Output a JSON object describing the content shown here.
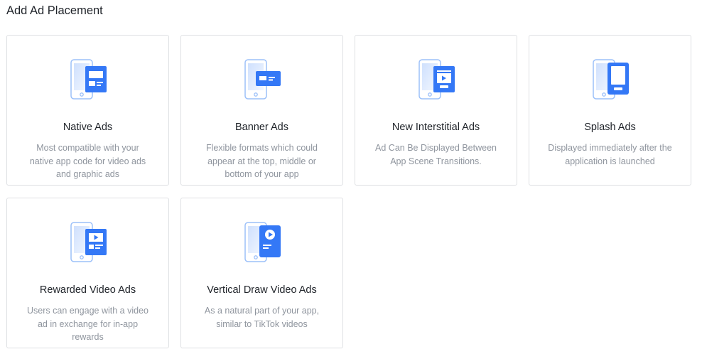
{
  "page": {
    "title": "Add Ad Placement"
  },
  "colors": {
    "accent": "#3478f6",
    "phone_outline": "#9cc0f9",
    "phone_fill": "#e6effe",
    "card_border": "#dee0e3",
    "title_text": "#1f2329",
    "desc_text": "#8f959e"
  },
  "placements": [
    {
      "icon": "native-ads-icon",
      "title": "Native Ads",
      "description": "Most compatible with your native app code for video ads and graphic ads"
    },
    {
      "icon": "banner-ads-icon",
      "title": "Banner Ads",
      "description": "Flexible formats which could appear at the top, middle or bottom of your app"
    },
    {
      "icon": "interstitial-ads-icon",
      "title": "New Interstitial Ads",
      "description": "Ad Can Be Displayed Between App Scene Transitions."
    },
    {
      "icon": "splash-ads-icon",
      "title": "Splash Ads",
      "description": "Displayed immediately after the application is launched"
    },
    {
      "icon": "rewarded-video-ads-icon",
      "title": "Rewarded Video Ads",
      "description": "Users can engage with a video ad in exchange for in-app rewards"
    },
    {
      "icon": "vertical-draw-video-ads-icon",
      "title": "Vertical Draw Video Ads",
      "description": "As a natural part of your app, similar to TikTok videos"
    }
  ]
}
